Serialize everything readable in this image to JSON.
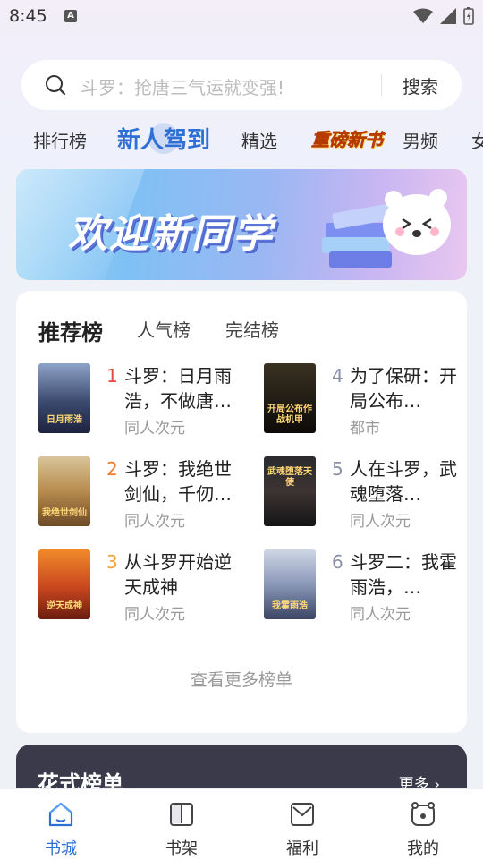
{
  "status_bar": {
    "time": "8:45",
    "notif_icon": "A"
  },
  "search": {
    "placeholder": "斗罗：抢唐三气运就变强!",
    "button_label": "搜索"
  },
  "tabs": [
    {
      "label": "排行榜"
    },
    {
      "label": "新人驾到",
      "active": true
    },
    {
      "label": "精选"
    },
    {
      "label": "重磅新书"
    },
    {
      "label": "男频"
    },
    {
      "label": "女"
    }
  ],
  "banner": {
    "text": "欢迎新同学"
  },
  "ranking": {
    "tabs": [
      "推荐榜",
      "人气榜",
      "完结榜"
    ],
    "books": [
      {
        "rank": "1",
        "title": "斗罗：日月雨浩，不做唐…",
        "category": "同人次元",
        "cover_text": "日月雨浩"
      },
      {
        "rank": "2",
        "title": "斗罗：我绝世剑仙，千仞…",
        "category": "同人次元",
        "cover_text": "我绝世剑仙"
      },
      {
        "rank": "3",
        "title": "从斗罗开始逆天成神",
        "category": "同人次元",
        "cover_text": "逆天成神"
      },
      {
        "rank": "4",
        "title": "为了保研：开局公布…",
        "category": "都市",
        "cover_text": "开局公布作战机甲"
      },
      {
        "rank": "5",
        "title": "人在斗罗，武魂堕落…",
        "category": "同人次元",
        "cover_text": "武魂堕落天使"
      },
      {
        "rank": "6",
        "title": "斗罗二：我霍雨浩，…",
        "category": "同人次元",
        "cover_text": "我霍雨浩"
      }
    ],
    "more_label": "查看更多榜单"
  },
  "fancy_list": {
    "title": "花式榜单",
    "more_label": "更多 ›"
  },
  "nav": [
    {
      "label": "书城",
      "icon": "home-icon",
      "active": true
    },
    {
      "label": "书架",
      "icon": "bookshelf-icon"
    },
    {
      "label": "福利",
      "icon": "gift-icon"
    },
    {
      "label": "我的",
      "icon": "profile-icon"
    }
  ],
  "colors": {
    "accent": "#2e6fd4",
    "rank1": "#e54646",
    "rank2": "#f07b2a",
    "rank3": "#f0a33a",
    "rank_other": "#8b8fa8"
  }
}
